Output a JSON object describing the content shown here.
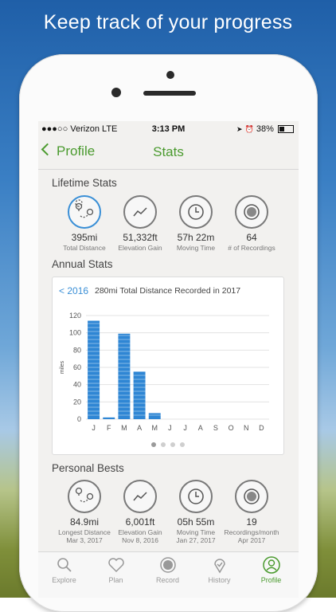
{
  "headline": "Keep track of your progress",
  "status": {
    "carrier": "●●●○○ Verizon  LTE",
    "time": "3:13 PM",
    "battery": "38%"
  },
  "nav": {
    "back_label": "Profile",
    "title": "Stats"
  },
  "lifetime": {
    "title": "Lifetime Stats",
    "items": [
      {
        "icon": "route-icon",
        "value": "395mi",
        "label": "Total Distance"
      },
      {
        "icon": "elevation-icon",
        "value": "51,332ft",
        "label": "Elevation Gain"
      },
      {
        "icon": "clock-icon",
        "value": "57h 22m",
        "label": "Moving Time"
      },
      {
        "icon": "record-icon",
        "value": "64",
        "label": "# of Recordings"
      }
    ]
  },
  "annual": {
    "title": "Annual Stats",
    "prev_label": "< 2016",
    "description": "280mi Total Distance Recorded in 2017"
  },
  "chart_data": {
    "type": "bar",
    "categories": [
      "J",
      "F",
      "M",
      "A",
      "M",
      "J",
      "J",
      "A",
      "S",
      "O",
      "N",
      "D"
    ],
    "values": [
      114,
      2,
      99,
      55,
      7,
      0,
      0,
      0,
      0,
      0,
      0,
      0
    ],
    "ylabel": "miles",
    "ylim": [
      0,
      120
    ],
    "yticks": [
      0,
      20,
      40,
      60,
      80,
      100,
      120
    ],
    "color": "#2f86d4",
    "grid": true
  },
  "bests": {
    "title": "Personal Bests",
    "items": [
      {
        "icon": "route-icon",
        "value": "84.9mi",
        "label": "Longest Distance",
        "date": "Mar 3, 2017"
      },
      {
        "icon": "elevation-icon",
        "value": "6,001ft",
        "label": "Elevation Gain",
        "date": "Nov 8, 2016"
      },
      {
        "icon": "clock-icon",
        "value": "05h 55m",
        "label": "Moving Time",
        "date": "Jan 27, 2017"
      },
      {
        "icon": "record-icon",
        "value": "19",
        "label": "Recordings/month",
        "date": "Apr 2017"
      }
    ]
  },
  "tabs": [
    {
      "label": "Explore",
      "icon": "search-icon"
    },
    {
      "label": "Plan",
      "icon": "heart-icon"
    },
    {
      "label": "Record",
      "icon": "record-icon"
    },
    {
      "label": "History",
      "icon": "location-icon"
    },
    {
      "label": "Profile",
      "icon": "profile-icon",
      "active": true
    }
  ],
  "colors": {
    "accent_green": "#4a9a2e",
    "accent_blue": "#3a8fd6"
  }
}
